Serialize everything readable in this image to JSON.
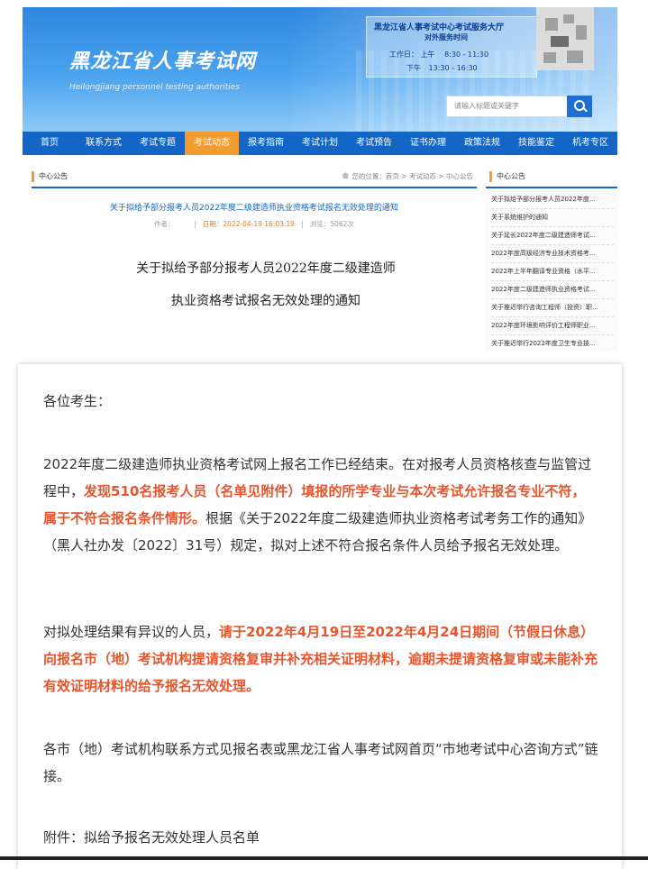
{
  "site": {
    "title": "黑龙江省人事考试网",
    "subtitle": "Heilongjiang personnel testing authorities",
    "service": {
      "title": "黑龙江省人事考试中心考试服务大厅",
      "hours_title": "对外服务时间",
      "weekday_label": "工作日：",
      "am_label": "上午",
      "am_time": "8:30 - 11:30",
      "pm_label": "下午",
      "pm_time": "13:30 - 16:30"
    },
    "search_placeholder": "请输入标题或关键字"
  },
  "nav": [
    "首页",
    "联系方式",
    "考试专题",
    "考试动态",
    "报考指南",
    "考试计划",
    "考试预告",
    "证书办理",
    "政策法规",
    "技能鉴定",
    "机考专区"
  ],
  "nav_active_index": 3,
  "panel": {
    "heading": "中心公告",
    "breadcrumb": "您的位置：首页 > 考试动态 > 中心公告",
    "article_title": "关于拟给予部分报考人员2022年度二级建造师执业资格考试报名无效处理的通知",
    "meta_author": "作者：",
    "meta_sep": "|",
    "meta_date": "日期：2022-04-19 16:03:19",
    "meta_views": "浏览：5062次",
    "big_title_1": "关于拟给予部分报考人员2022年度二级建造师",
    "big_title_2": "执业资格考试报名无效处理的通知"
  },
  "side": {
    "heading": "中心公告",
    "items": [
      "关于拟给予部分报考人员2022年度...",
      "关于系统维护的通知",
      "关于延长2022年度二级建造师考试...",
      "2022年度高级经济专业技术资格考...",
      "2022年上半年翻译专业资格（水平...",
      "2022年度二级建造师执业资格考试...",
      "关于推迟举行咨询工程师（投资）职...",
      "2022年度环境影响评价工程师职业...",
      "关于推迟举行2022年度卫生专业技..."
    ]
  },
  "body": {
    "greeting": "各位考生：",
    "p1_a": "2022年度二级建造师执业资格考试网上报名工作已经结束。在对报考人员资格核查与监管过程中，",
    "p1_b": "发现510名报考人员（名单见附件）填报的所学专业与本次考试允许报名专业不符，属于不符合报名条件情形。",
    "p1_c": "根据《关于2022年度二级建造师执业资格考试考务工作的通知》（黑人社办发〔2022〕31号）规定，拟对上述不符合报名条件人员给予报名无效处理。",
    "p2_a": "对拟处理结果有异议的人员，",
    "p2_b": "请于2022年4月19日至2022年4月24日期间（节假日休息）向报名市（地）考试机构提请资格复审并补充相关证明材料，逾期未提请资格复审或未能补充有效证明材料的给予报名无效处理。",
    "p3": "各市（地）考试机构联系方式见报名表或黑龙江省人事考试网首页“市地考试中心咨询方式”链接。",
    "attachment": "附件：拟给予报名无效处理人员名单"
  }
}
